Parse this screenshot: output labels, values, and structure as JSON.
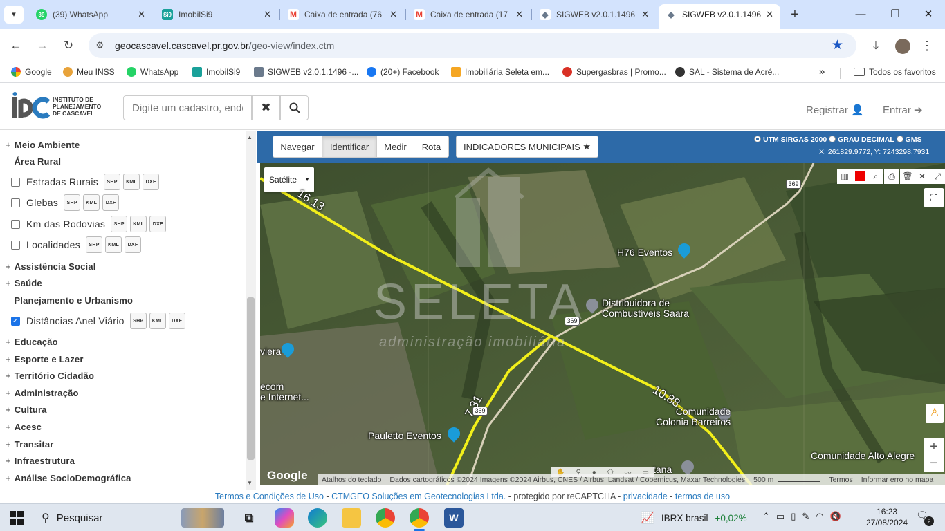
{
  "browser": {
    "tabs": [
      {
        "title": "(39) WhatsApp",
        "icon": "whatsapp-icon",
        "color": "#25d366",
        "badge": "39"
      },
      {
        "title": "ImobilSi9",
        "icon": "imobilsi9-icon",
        "color": "#1aa19a",
        "badge": "Si9"
      },
      {
        "title": "Caixa de entrada (76",
        "icon": "gmail-icon",
        "color": "#ea4335",
        "badge": "M"
      },
      {
        "title": "Caixa de entrada (17",
        "icon": "gmail-icon",
        "color": "#ea4335",
        "badge": "M"
      },
      {
        "title": "SIGWEB v2.0.1.1496",
        "icon": "sigweb-icon",
        "color": "#6b7a8c",
        "badge": "◆"
      },
      {
        "title": "SIGWEB v2.0.1.1496",
        "icon": "sigweb-icon",
        "color": "#6b7a8c",
        "badge": "◆"
      }
    ],
    "url_host": "geocascavel.cascavel.pr.gov.br",
    "url_path": "/geo-view/index.ctm",
    "bookmarks": [
      {
        "label": "Google",
        "color": "#4285f4"
      },
      {
        "label": "Meu INSS",
        "color": "#e8a33a"
      },
      {
        "label": "WhatsApp",
        "color": "#25d366"
      },
      {
        "label": "ImobilSi9",
        "color": "#1aa19a"
      },
      {
        "label": "SIGWEB v2.0.1.1496 -...",
        "color": "#6b7a8c"
      },
      {
        "label": "(20+) Facebook",
        "color": "#1877f2"
      },
      {
        "label": "Imobiliária Seleta em...",
        "color": "#f5a623"
      },
      {
        "label": "Supergasbras | Promo...",
        "color": "#d93025"
      },
      {
        "label": "SAL - Sistema de Acré...",
        "color": "#333333"
      }
    ],
    "bookmarks_more": "»",
    "all_favorites": "Todos os favoritos"
  },
  "header": {
    "logo_abbrev": "ipc",
    "logo_line1": "INSTITUTO DE",
    "logo_line2": "PLANEJAMENTO",
    "logo_line3": "DE CASCAVEL",
    "search_placeholder": "Digite um cadastro, endereço",
    "register": "Registrar",
    "login": "Entrar"
  },
  "sidebar": {
    "meio_ambiente": "Meio Ambiente",
    "area_rural": "Área Rural",
    "estradas": "Estradas Rurais",
    "glebas": "Glebas",
    "km_rodovias": "Km das Rodovias",
    "localidades": "Localidades",
    "assistencia": "Assistência Social",
    "saude": "Saúde",
    "planejamento": "Planejamento e Urbanismo",
    "anel": "Distâncias Anel Viário",
    "educacao": "Educação",
    "esporte": "Esporte e Lazer",
    "territorio": "Território Cidadão",
    "administracao": "Administração",
    "cultura": "Cultura",
    "acesc": "Acesc",
    "transitar": "Transitar",
    "infraestrutura": "Infraestrutura",
    "socio": "Análise SocioDemográfica",
    "plus": "+",
    "minus": "–",
    "file_shp": "SHP",
    "file_kml": "KML",
    "file_dxf": "DXF"
  },
  "map_toolbar": {
    "navegar": "Navegar",
    "identificar": "Identificar",
    "medir": "Medir",
    "rota": "Rota",
    "indicadores": "INDICADORES MUNICIPAIS",
    "utm": "UTM SIRGAS 2000",
    "grau": "GRAU DECIMAL",
    "gms": "GMS",
    "coords": "X: 261829.9772, Y: 7243298.7931"
  },
  "map": {
    "basemap": "Satélite",
    "watermark": "SELETA",
    "watermark_sub": "administração imobiliária",
    "labels": {
      "h76": "H76 Eventos",
      "dist1": "Distribuidora de",
      "dist2": "Combustíveis Saara",
      "pauletto": "Pauletto Eventos",
      "comunidade1": "Comunidade",
      "comunidade2": "Colonia Barreiros",
      "alto": "Comunidade Alto Alegre",
      "viera": "viera",
      "ecom1": "ecom",
      "ecom2": "e Internet...",
      "tana": "tana",
      "road": "369",
      "d1": "16.13",
      "d2": "10.88",
      "d3": "7.31"
    },
    "attribution": {
      "google": "Google",
      "shortcuts": "Atalhos do teclado",
      "data": "Dados cartográficos ©2024 Imagens ©2024 Airbus, CNES / Airbus, Landsat / Copernicus, Maxar Technologies",
      "scale": "500 m",
      "terms": "Termos",
      "report": "Informar erro no mapa"
    }
  },
  "footer": {
    "terms": "Termos e Condições de Uso",
    "sep1": " - ",
    "ctm": "CTMGEO Soluções em Geotecnologias Ltda.",
    "mid": " - protegido por reCAPTCHA - ",
    "privacy": "privacidade",
    "sep2": " - ",
    "termsuse": "termos de uso"
  },
  "taskbar": {
    "search": "Pesquisar",
    "stock_name": "IBRX brasil",
    "stock_change": "+0,02%",
    "time": "16:23",
    "date": "27/08/2024",
    "notif": "2"
  }
}
